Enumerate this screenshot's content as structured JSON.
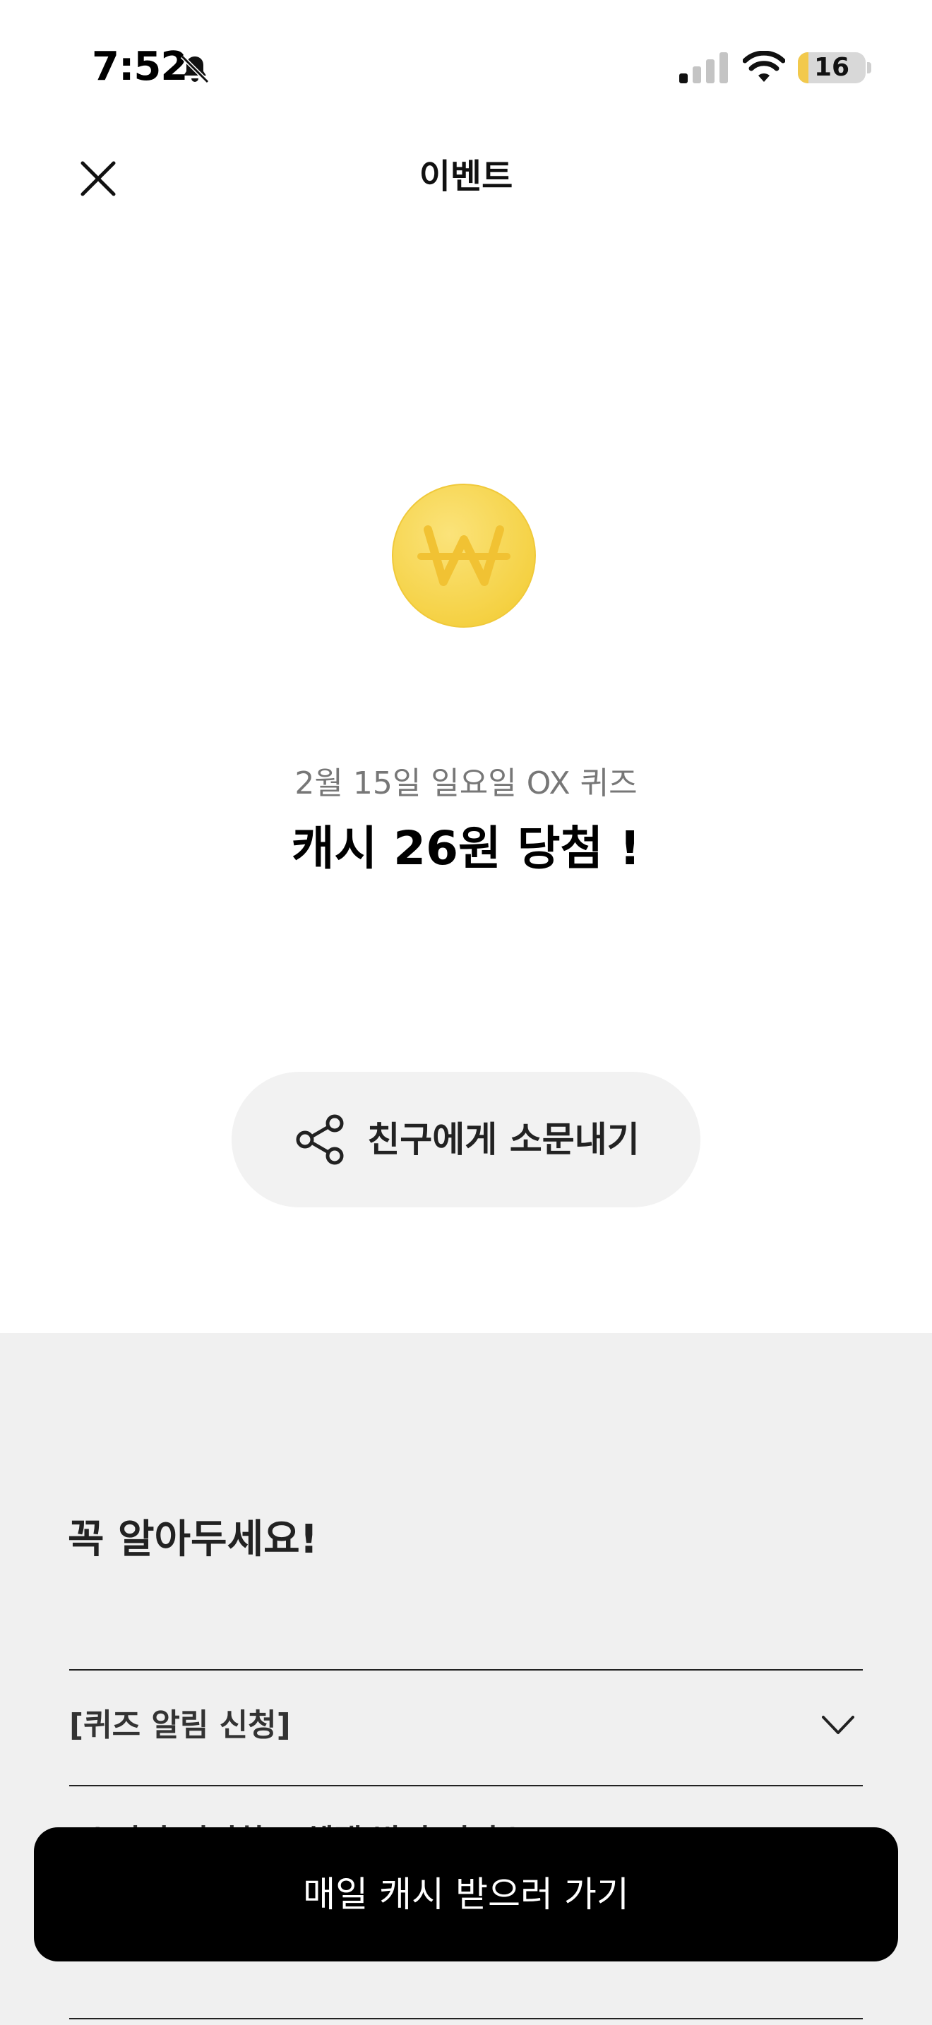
{
  "status_bar": {
    "time": "7:52",
    "battery_level": "16",
    "battery_fraction": 0.16
  },
  "nav": {
    "title": "이벤트"
  },
  "prize": {
    "quiz_date": "2월 15일 일요일 OX 퀴즈",
    "message": "캐시 26원 당첨 !"
  },
  "share": {
    "label": "친구에게 소문내기"
  },
  "info": {
    "title": "꼭 알아두세요!",
    "items": [
      {
        "label": "[퀴즈 알림 신청]"
      },
      {
        "label": "[쇼핑더 편리하고 혜택 받기 서비스]"
      }
    ]
  },
  "cta": {
    "label": "매일 캐시 받으러 가기"
  },
  "colors": {
    "coin": "#f7d84a",
    "cta_bg": "#000000",
    "share_bg": "#f2f2f2",
    "section_bg": "#f0f0f0",
    "battery": "#f2c94c"
  },
  "icons": {
    "close": "close-icon",
    "share": "share-icon",
    "chevron": "chevron-down-icon",
    "coin": "won-coin-icon"
  }
}
